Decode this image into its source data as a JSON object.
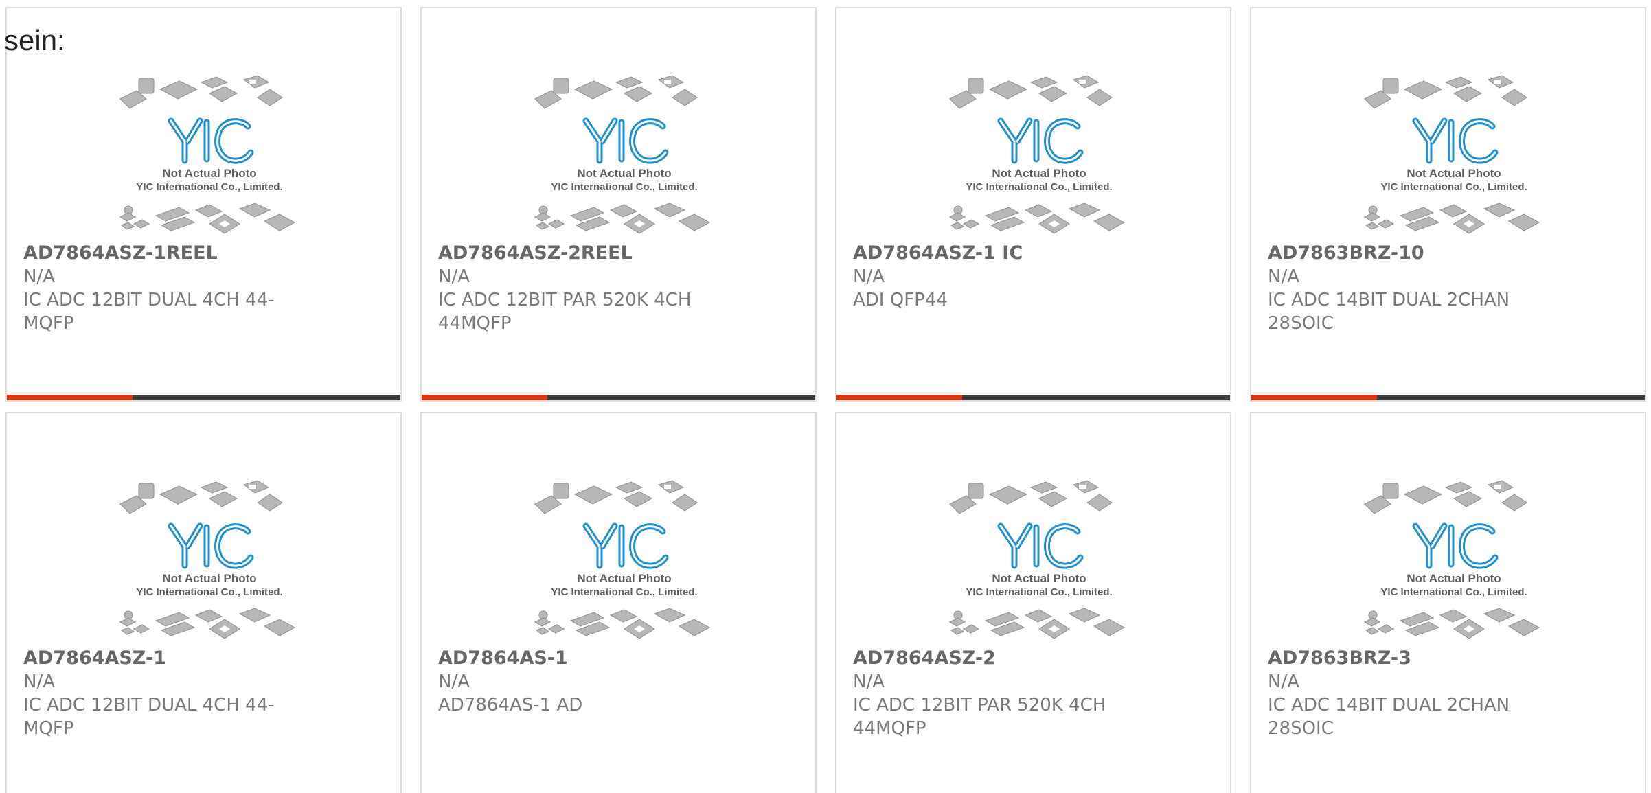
{
  "page": {
    "heading": "sein:"
  },
  "image": {
    "logo_text": "YIC",
    "line1": "Not Actual Photo",
    "line2": "YIC International Co., Limited."
  },
  "colors": {
    "accent": "#d9360f",
    "bar": "#3d3d3d",
    "logo": "#1f8fd1",
    "border": "#dcdcdc"
  },
  "products": [
    {
      "part": "AD7864ASZ-1REEL",
      "mfr": "N/A",
      "desc": "IC ADC 12BIT DUAL 4CH 44-MQFP"
    },
    {
      "part": "AD7864ASZ-2REEL",
      "mfr": "N/A",
      "desc": "IC ADC 12BIT PAR 520K 4CH 44MQFP"
    },
    {
      "part": "AD7864ASZ-1 IC",
      "mfr": "N/A",
      "desc": "ADI QFP44"
    },
    {
      "part": "AD7863BRZ-10",
      "mfr": "N/A",
      "desc": "IC ADC 14BIT DUAL 2CHAN 28SOIC"
    },
    {
      "part": "AD7864ASZ-1",
      "mfr": "N/A",
      "desc": "IC ADC 12BIT DUAL 4CH 44-MQFP"
    },
    {
      "part": "AD7864AS-1",
      "mfr": "N/A",
      "desc": "AD7864AS-1 AD"
    },
    {
      "part": "AD7864ASZ-2",
      "mfr": "N/A",
      "desc": "IC ADC 12BIT PAR 520K 4CH 44MQFP"
    },
    {
      "part": "AD7863BRZ-3",
      "mfr": "N/A",
      "desc": "IC ADC 14BIT DUAL 2CHAN 28SOIC"
    }
  ]
}
